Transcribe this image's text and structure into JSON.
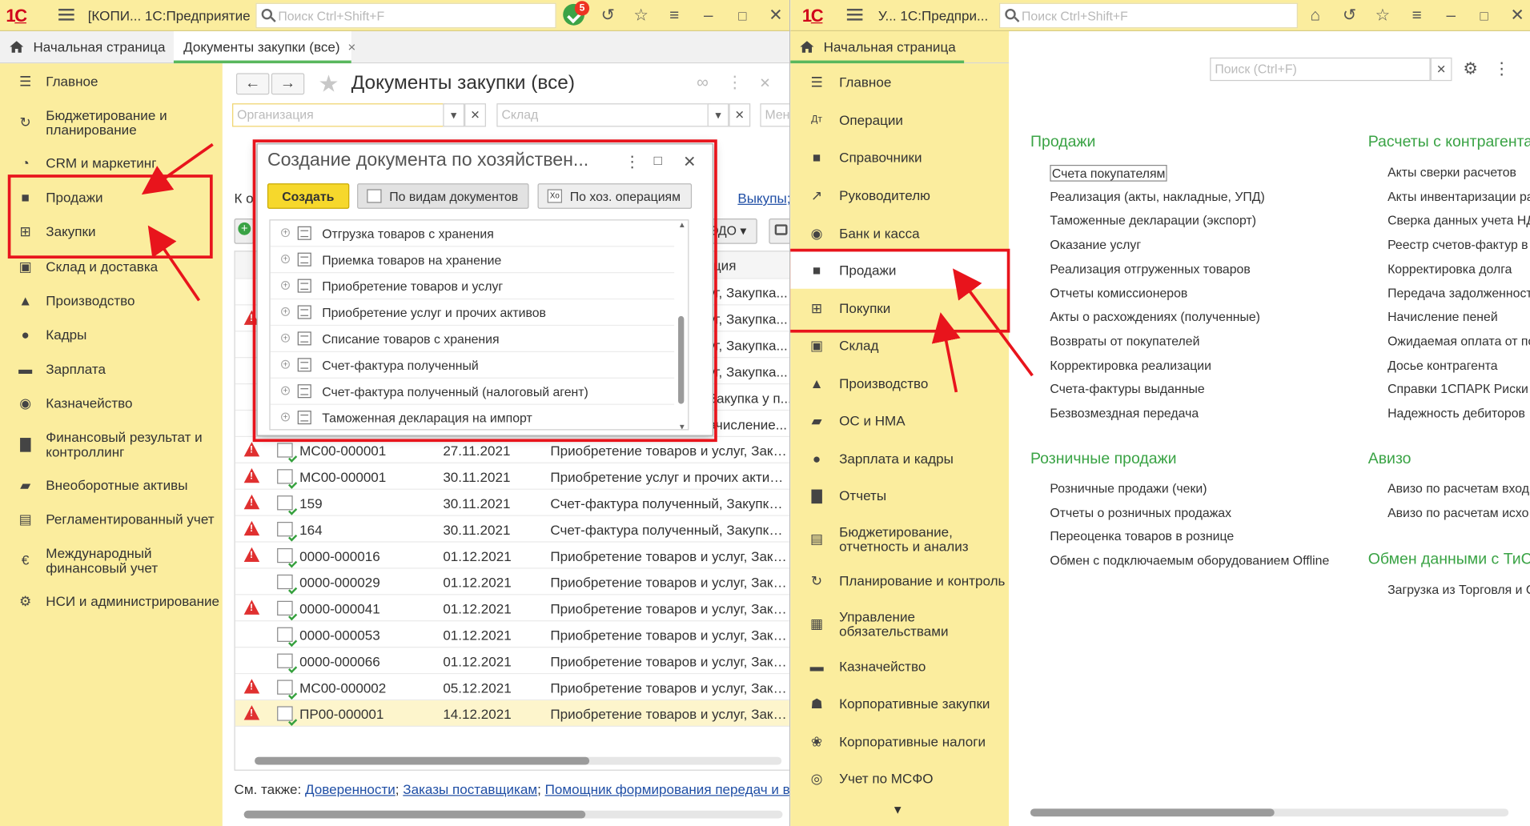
{
  "left_window": {
    "title": "[КОПИ... 1С:Предприятие",
    "search_placeholder": "Поиск Ctrl+Shift+F",
    "notifications_count": "5",
    "tabs": [
      "Начальная страница",
      "Документы закупки (все)"
    ],
    "tab_close": "×",
    "sidebar": [
      "Главное",
      "Бюджетирование и планирование",
      "CRM и маркетинг",
      "Продажи",
      "Закупки",
      "Склад и доставка",
      "Производство",
      "Кадры",
      "Зарплата",
      "Казначейство",
      "Финансовый результат и контроллинг",
      "Внеоборотные активы",
      "Регламентированный учет",
      "Международный финансовый учет",
      "НСИ и администрирование"
    ],
    "page_title": "Документы закупки (все)",
    "filters": {
      "org_placeholder": "Организация",
      "warehouse_placeholder": "Склад",
      "manager_placeholder": "Мене"
    },
    "partial_text": {
      "ko": "К о",
      "links_right": "Выкупы; Спи",
      "edo_button": "ЭДО",
      "col_header_partial": "ция"
    },
    "hidden_row_snippets": [
      "уг, Закупка...",
      "уг, Закупка...",
      "уг, Закупка...",
      "уг, Закупка...",
      "Закупка у п...",
      "ачисление..."
    ],
    "rows": [
      {
        "warn": true,
        "number": "МС00-000001",
        "date": "27.11.2021",
        "desc": "Приобретение товаров и услуг, Закупка..."
      },
      {
        "warn": true,
        "number": "МС00-000001",
        "date": "30.11.2021",
        "desc": "Приобретение услуг и прочих активов, ..."
      },
      {
        "warn": true,
        "number": "159",
        "date": "30.11.2021",
        "desc": "Счет-фактура полученный, Закупка у п..."
      },
      {
        "warn": true,
        "number": "164",
        "date": "30.11.2021",
        "desc": "Счет-фактура полученный, Закупка у п..."
      },
      {
        "warn": true,
        "number": "0000-000016",
        "date": "01.12.2021",
        "desc": "Приобретение товаров и услуг, Закупка..."
      },
      {
        "warn": false,
        "number": "0000-000029",
        "date": "01.12.2021",
        "desc": "Приобретение товаров и услуг, Закупка..."
      },
      {
        "warn": true,
        "number": "0000-000041",
        "date": "01.12.2021",
        "desc": "Приобретение товаров и услуг, Закупка..."
      },
      {
        "warn": false,
        "number": "0000-000053",
        "date": "01.12.2021",
        "desc": "Приобретение товаров и услуг, Закупка..."
      },
      {
        "warn": false,
        "number": "0000-000066",
        "date": "01.12.2021",
        "desc": "Приобретение товаров и услуг, Закупка..."
      },
      {
        "warn": true,
        "number": "МС00-000002",
        "date": "05.12.2021",
        "desc": "Приобретение товаров и услуг, Закупка..."
      },
      {
        "warn": true,
        "number": "ПР00-000001",
        "date": "14.12.2021",
        "desc": "Приобретение товаров и услуг, Закупка..."
      }
    ],
    "see_also": {
      "prefix": "См. также: ",
      "links": [
        "Доверенности",
        "Заказы поставщикам",
        "Помощник формирования передач и выкупов"
      ],
      "sep": ";"
    },
    "dialog": {
      "title": "Создание документа по хозяйствен...",
      "create_button": "Создать",
      "by_doc_types": "По видам документов",
      "by_operations": "По хоз. операциям",
      "items": [
        "Отгрузка товаров с хранения",
        "Приемка товаров на хранение",
        "Приобретение товаров и услуг",
        "Приобретение услуг и прочих активов",
        "Списание товаров с хранения",
        "Счет-фактура полученный",
        "Счет-фактура полученный (налоговый агент)",
        "Таможенная декларация на импорт"
      ]
    }
  },
  "right_window": {
    "title": "У... 1С:Предпри...",
    "search_placeholder": "Поиск Ctrl+Shift+F",
    "home_tab": "Начальная страница",
    "sidebar": [
      "Главное",
      "Операции",
      "Справочники",
      "Руководителю",
      "Банк и касса",
      "Продажи",
      "Покупки",
      "Склад",
      "Производство",
      "ОС и НМА",
      "Зарплата и кадры",
      "Отчеты",
      "Бюджетирование, отчетность и анализ",
      "Планирование и контроль",
      "Управление обязательствами",
      "Казначейство",
      "Корпоративные закупки",
      "Корпоративные налоги",
      "Учет по МСФО"
    ],
    "search_placeholder_panel": "Поиск (Ctrl+F)",
    "sections": {
      "sales": {
        "title": "Продажи",
        "links": [
          "Счета покупателям",
          "Реализация (акты, накладные, УПД)",
          "Таможенные декларации (экспорт)",
          "Оказание услуг",
          "Реализация отгруженных товаров",
          "Отчеты комиссионеров",
          "Акты о расхождениях (полученные)",
          "Возвраты от покупателей",
          "Корректировка реализации",
          "Счета-фактуры выданные",
          "Безвозмездная передача"
        ]
      },
      "retail": {
        "title": "Розничные продажи",
        "links": [
          "Розничные продажи (чеки)",
          "Отчеты о розничных продажах",
          "Переоценка товаров в рознице",
          "Обмен с подключаемым оборудованием Offline"
        ]
      },
      "settlements": {
        "title": "Расчеты с контрагента",
        "links": [
          "Акты сверки расчетов",
          "Акты инвентаризации ра",
          "Сверка данных учета НД",
          "Реестр счетов-фактур в",
          "Корректировка долга",
          "Передача задолженност",
          "Начисление пеней",
          "Ожидаемая оплата от по",
          "Досье контрагента",
          "Справки 1СПАРК Риски",
          "Надежность дебиторов"
        ]
      },
      "aviso": {
        "title": "Авизо",
        "links": [
          "Авизо по расчетам вход",
          "Авизо по расчетам исхо"
        ]
      },
      "exchange": {
        "title": "Обмен данными с ТиС",
        "links": [
          "Загрузка из Торговля и С"
        ]
      }
    }
  },
  "colors": {
    "sidebar_bg": "#fbed9e",
    "accent_green": "#3aa345",
    "highlight_red": "#e8141c",
    "create_yellow": "#f6d82c",
    "link_blue": "#1f4ea5"
  }
}
